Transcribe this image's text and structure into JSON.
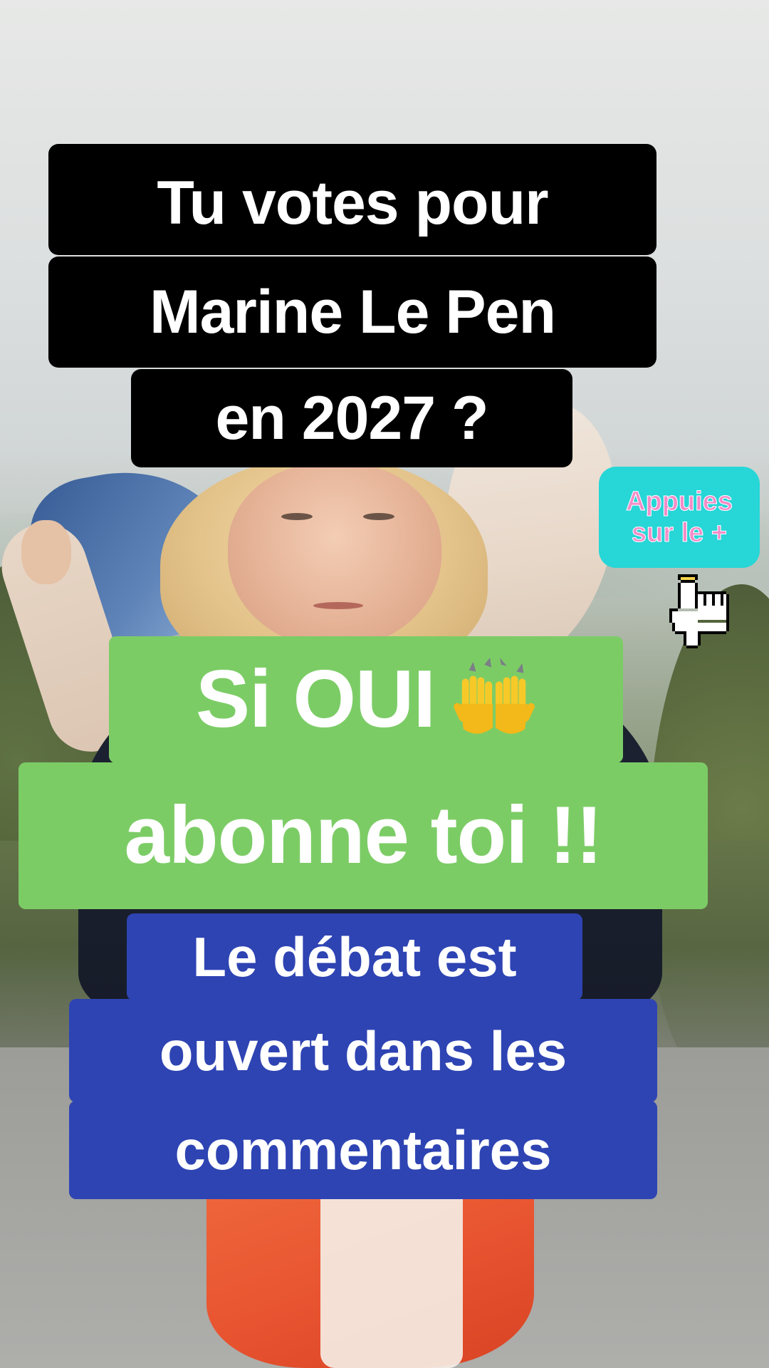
{
  "headline": {
    "line1": "Tu votes pour",
    "line2": "Marine Le Pen",
    "line3": "en 2027 ?"
  },
  "call_to_action": {
    "line1": "Si OUI",
    "line2": "abonne toi !!",
    "emoji_icon": "raised-hands-icon"
  },
  "debate": {
    "line1": "Le débat est",
    "line2": "ouvert dans les",
    "line3": "commentaires"
  },
  "sticker": {
    "line1": "Appuies",
    "line2": "sur le +",
    "pointer_icon": "pointing-hand-cursor-icon"
  },
  "colors": {
    "headline_bg": "#000000",
    "cta_bg": "#7ccc66",
    "debate_bg": "#2e44b3",
    "sticker_bg": "#27d6d6",
    "sticker_text": "#f38cc8"
  }
}
